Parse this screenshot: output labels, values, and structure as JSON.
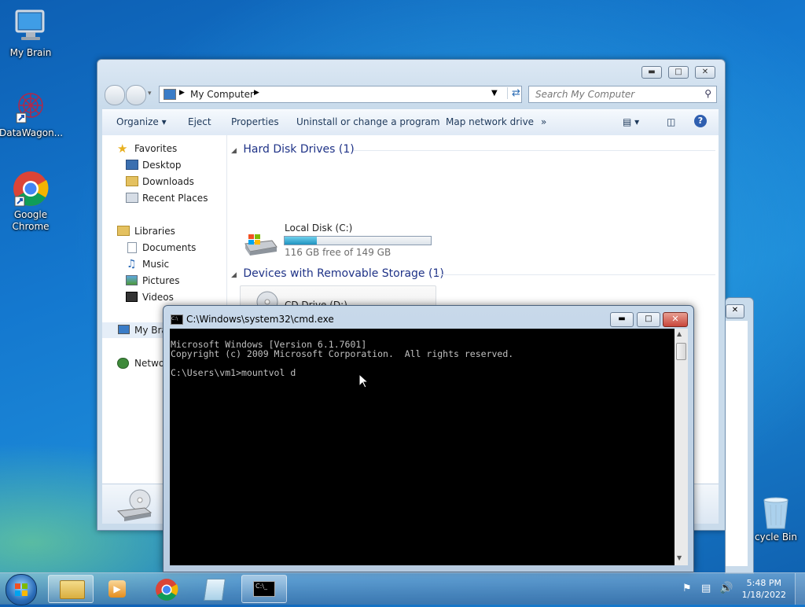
{
  "desktop": {
    "icons": [
      {
        "label": "My Brain"
      },
      {
        "label": "DataWagon..."
      },
      {
        "label": "Google Chrome"
      },
      {
        "label": "cycle Bin"
      }
    ]
  },
  "explorer": {
    "address_crumb": "My Computer",
    "search_placeholder": "Search My Computer",
    "toolbar": {
      "organize": "Organize",
      "eject": "Eject",
      "properties": "Properties",
      "uninstall": "Uninstall or change a program",
      "map_drive": "Map network drive",
      "more": "»"
    },
    "nav": {
      "favorites": "Favorites",
      "desktop": "Desktop",
      "downloads": "Downloads",
      "recent": "Recent Places",
      "libraries": "Libraries",
      "documents": "Documents",
      "music": "Music",
      "pictures": "Pictures",
      "videos": "Videos",
      "computer_partial": "My Bra",
      "network_partial": "Netwo"
    },
    "groups": {
      "hdd_title": "Hard Disk Drives (1)",
      "removable_title": "Devices with Removable Storage (1)"
    },
    "local_disk": {
      "name": "Local Disk (C:)",
      "free_text": "116 GB free of 149 GB",
      "used_fraction": 0.22
    },
    "cd_drive": {
      "name": "CD Drive (D:)"
    }
  },
  "cmd": {
    "title": "C:\\Windows\\system32\\cmd.exe",
    "lines": [
      "Microsoft Windows [Version 6.1.7601]",
      "Copyright (c) 2009 Microsoft Corporation.  All rights reserved.",
      "",
      "C:\\Users\\vm1>mountvol d"
    ]
  },
  "taskbar": {
    "time": "5:48 PM",
    "date": "1/18/2022"
  },
  "colors": {
    "accent": "#1e3287",
    "progress": "#2aa0c8",
    "close_red": "#c8453a"
  }
}
